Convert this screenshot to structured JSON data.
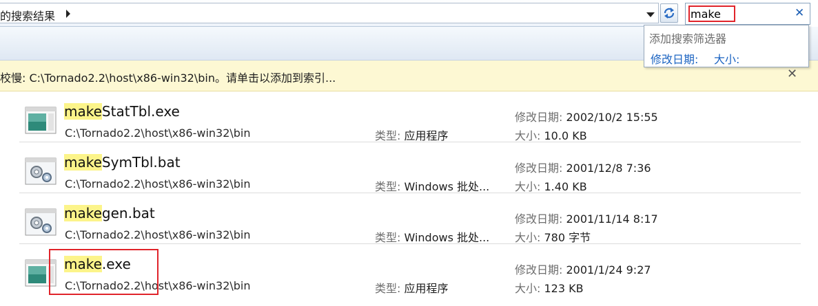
{
  "address": {
    "breadcrumb": "的搜索结果"
  },
  "search": {
    "value": "make",
    "suggestions_title": "添加搜索筛选器",
    "filters": [
      "修改日期:",
      "大小:"
    ]
  },
  "infobar": {
    "message": "校慢: C:\\Tornado2.2\\host\\x86-win32\\bin。请单击以添加到索引..."
  },
  "labels": {
    "type": "类型:",
    "modified": "修改日期:",
    "size": "大小:"
  },
  "results": [
    {
      "highlight": "make",
      "rest": "StatTbl.exe",
      "path": "C:\\Tornado2.2\\host\\x86-win32\\bin",
      "type": "应用程序",
      "modified": "2002/10/2 15:55",
      "size": "10.0 KB",
      "icon": "exe-icon"
    },
    {
      "highlight": "make",
      "rest": "SymTbl.bat",
      "path": "C:\\Tornado2.2\\host\\x86-win32\\bin",
      "type": "Windows 批处...",
      "modified": "2001/12/8 7:36",
      "size": "1.40 KB",
      "icon": "batch-gear-icon"
    },
    {
      "highlight": "make",
      "rest": "gen.bat",
      "path": "C:\\Tornado2.2\\host\\x86-win32\\bin",
      "type": "Windows 批处...",
      "modified": "2001/11/14 8:17",
      "size": "780 字节",
      "icon": "batch-gear-icon"
    },
    {
      "highlight": "make",
      "rest": ".exe",
      "path": "C:\\Tornado2.2\\host\\x86-win32\\bin",
      "type": "应用程序",
      "modified": "2001/1/24 9:27",
      "size": "123 KB",
      "icon": "exe-icon"
    }
  ],
  "colors": {
    "highlight": "#fcf48a",
    "link": "#1c64c2",
    "annotation": "#e0232a",
    "infobar": "#fdf8d3"
  }
}
